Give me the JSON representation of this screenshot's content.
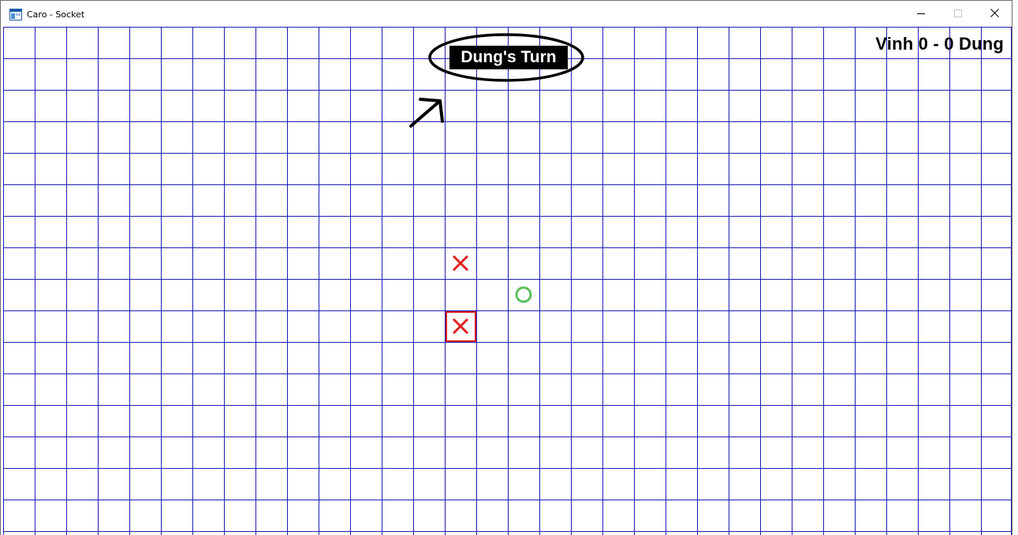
{
  "window": {
    "title": "Caro - Socket",
    "app_icon": "window-icon",
    "controls": [
      "minimize-icon",
      "maximize-icon",
      "close-icon"
    ]
  },
  "game": {
    "turn_label": "Dung's Turn",
    "score_text": "Vinh 0 - 0 Dung",
    "players": [
      {
        "name": "Vinh",
        "score": 0,
        "mark": "X",
        "color": "#e02020"
      },
      {
        "name": "Dung",
        "score": 0,
        "mark": "O",
        "color": "#5cc05c"
      }
    ],
    "grid_color": "#1f1fb5",
    "moves": [
      {
        "mark": "X",
        "col": 14,
        "row": 7
      },
      {
        "mark": "O",
        "col": 16,
        "row": 8
      },
      {
        "mark": "X",
        "col": 14,
        "row": 9,
        "last_move": true
      }
    ],
    "highlight_color": "#d11a1a"
  }
}
